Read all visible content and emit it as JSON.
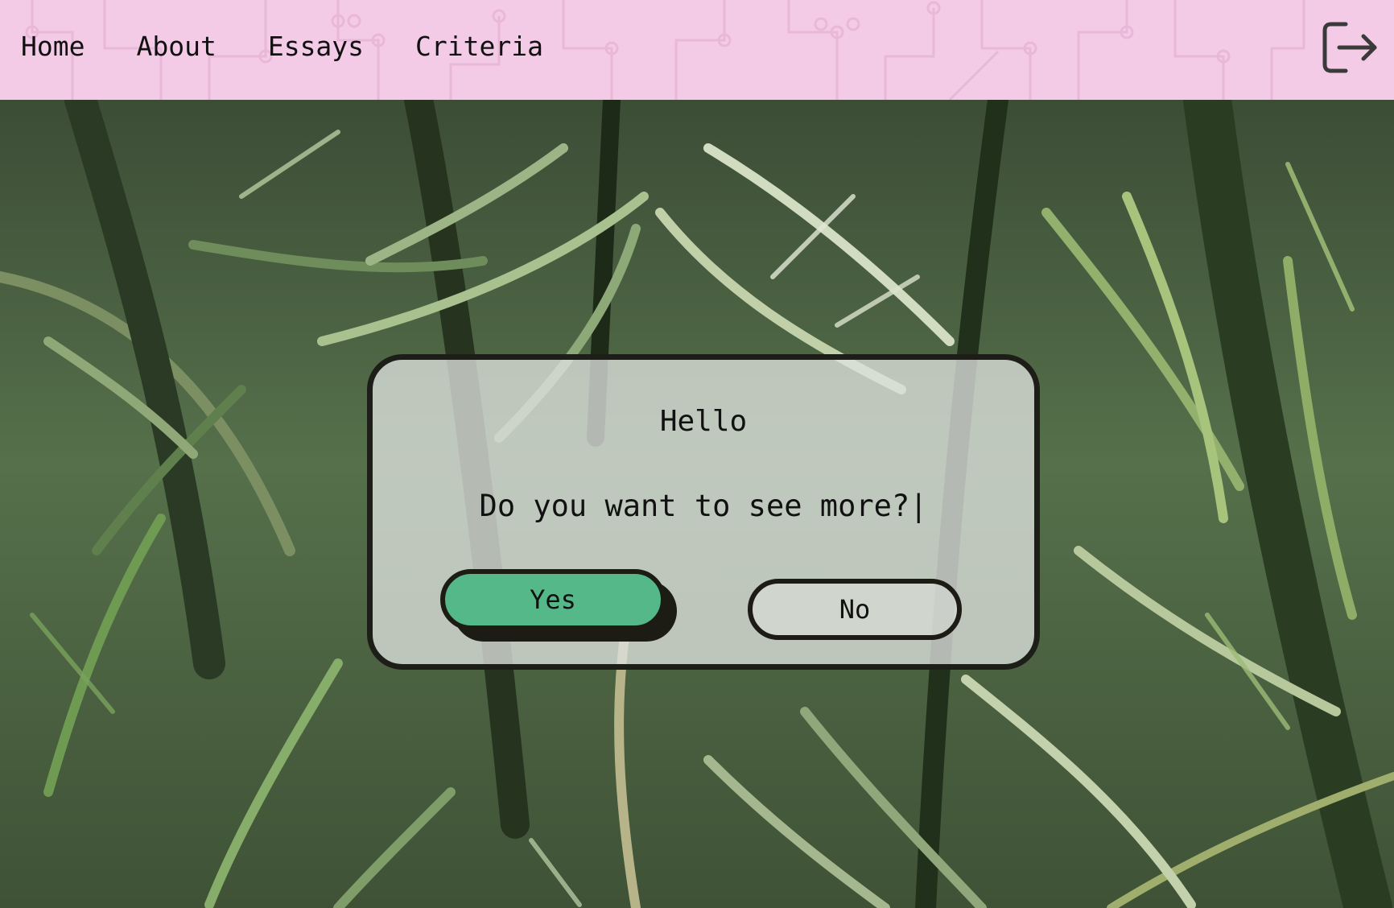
{
  "nav": {
    "items": [
      {
        "label": "Home"
      },
      {
        "label": "About"
      },
      {
        "label": "Essays"
      },
      {
        "label": "Criteria"
      }
    ],
    "logout_icon": "logout-icon"
  },
  "dialog": {
    "title": "Hello",
    "message": "Do you want to see more?|",
    "yes_label": "Yes",
    "no_label": "No"
  },
  "colors": {
    "topbar": "#f4cbe6",
    "yes_button": "#55b889",
    "border": "#1e1e18"
  }
}
